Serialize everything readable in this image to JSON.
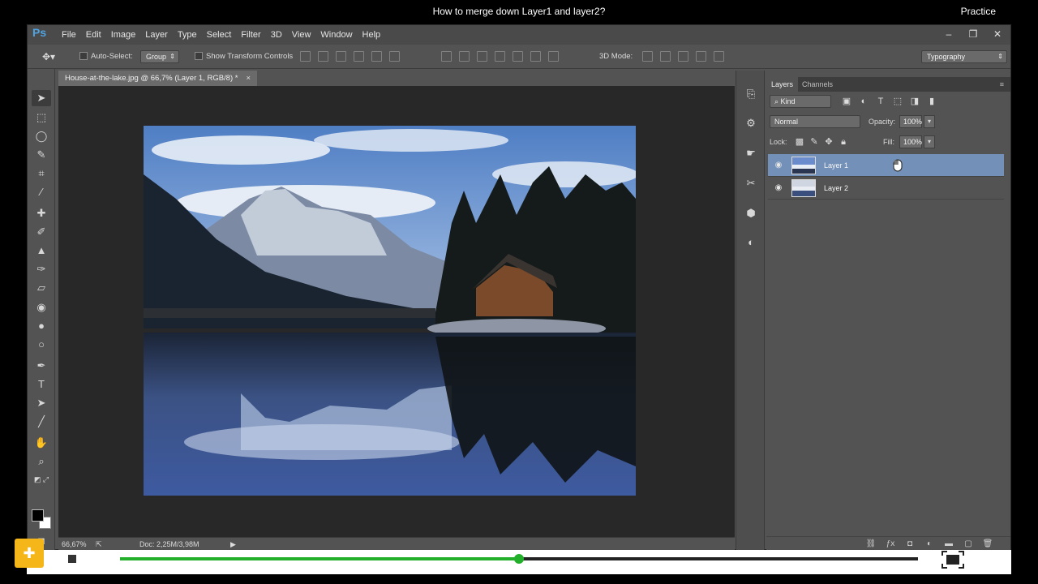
{
  "tutorial": {
    "title": "How to merge down Layer1 and layer2?",
    "mode": "Practice",
    "progress": 0.5
  },
  "app": {
    "logo": "Ps",
    "menu": [
      "File",
      "Edit",
      "Image",
      "Layer",
      "Type",
      "Select",
      "Filter",
      "3D",
      "View",
      "Window",
      "Help"
    ],
    "window_buttons": [
      "–",
      "❐",
      "✕"
    ]
  },
  "options": {
    "auto_select_label": "Auto-Select:",
    "auto_select_value": "Group",
    "show_transform_label": "Show Transform Controls",
    "mode_3d_label": "3D Mode:",
    "workspace": "Typography"
  },
  "document": {
    "tab_title": "House-at-the-lake.jpg @ 66,7% (Layer 1, RGB/8) *",
    "zoom": "66,67%",
    "doc_size": "Doc: 2,25M/3,98M"
  },
  "layers_panel": {
    "tabs": [
      "Layers",
      "Channels"
    ],
    "filter_kind": "Kind",
    "blend_mode": "Normal",
    "opacity_label": "Opacity:",
    "opacity_value": "100%",
    "lock_label": "Lock:",
    "fill_label": "Fill:",
    "fill_value": "100%",
    "layers": [
      {
        "name": "Layer 1",
        "selected": true
      },
      {
        "name": "Layer 2",
        "selected": false
      }
    ]
  },
  "colors": {
    "accent_progress": "#22b02a",
    "selected_layer": "#7391b8",
    "help_button": "#f5b61a"
  }
}
